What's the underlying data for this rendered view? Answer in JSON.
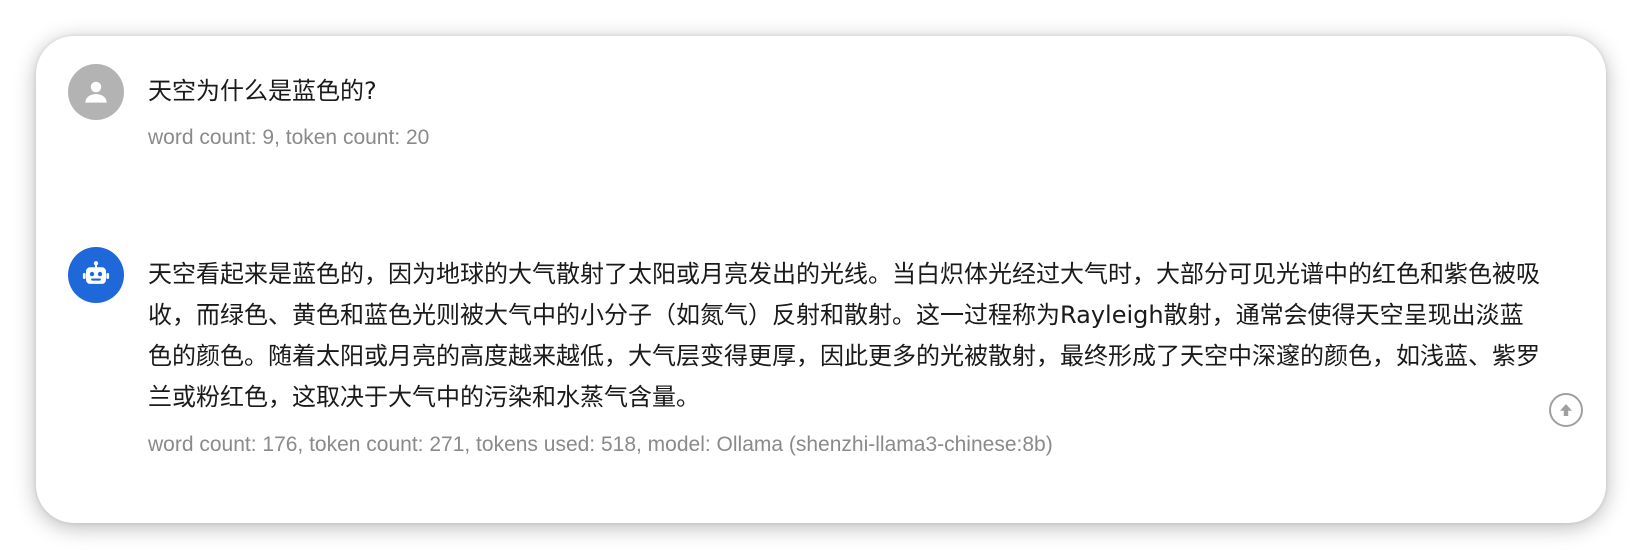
{
  "messages": [
    {
      "role": "user",
      "avatar_icon": "user-icon",
      "text": "天空为什么是蓝色的?",
      "meta": "word count: 9, token count: 20"
    },
    {
      "role": "assistant",
      "avatar_icon": "robot-icon",
      "text": "天空看起来是蓝色的，因为地球的大气散射了太阳或月亮发出的光线。当白炽体光经过大气时，大部分可见光谱中的红色和紫色被吸收，而绿色、黄色和蓝色光则被大气中的小分子（如氮气）反射和散射。这一过程称为Rayleigh散射，通常会使得天空呈现出淡蓝色的颜色。随着太阳或月亮的高度越来越低，大气层变得更厚，因此更多的光被散射，最终形成了天空中深邃的颜色，如浅蓝、紫罗兰或粉红色，这取决于大气中的污染和水蒸气含量。",
      "meta": "word count: 176, token count: 271, tokens used: 518, model: Ollama (shenzhi-llama3-chinese:8b)"
    }
  ],
  "scroll_button_icon": "arrow-up-circle-icon",
  "colors": {
    "user_avatar": "#b3b3b3",
    "bot_avatar": "#1f68d9",
    "meta_text": "#8a8a8a",
    "body_text": "#1a1a1a"
  }
}
